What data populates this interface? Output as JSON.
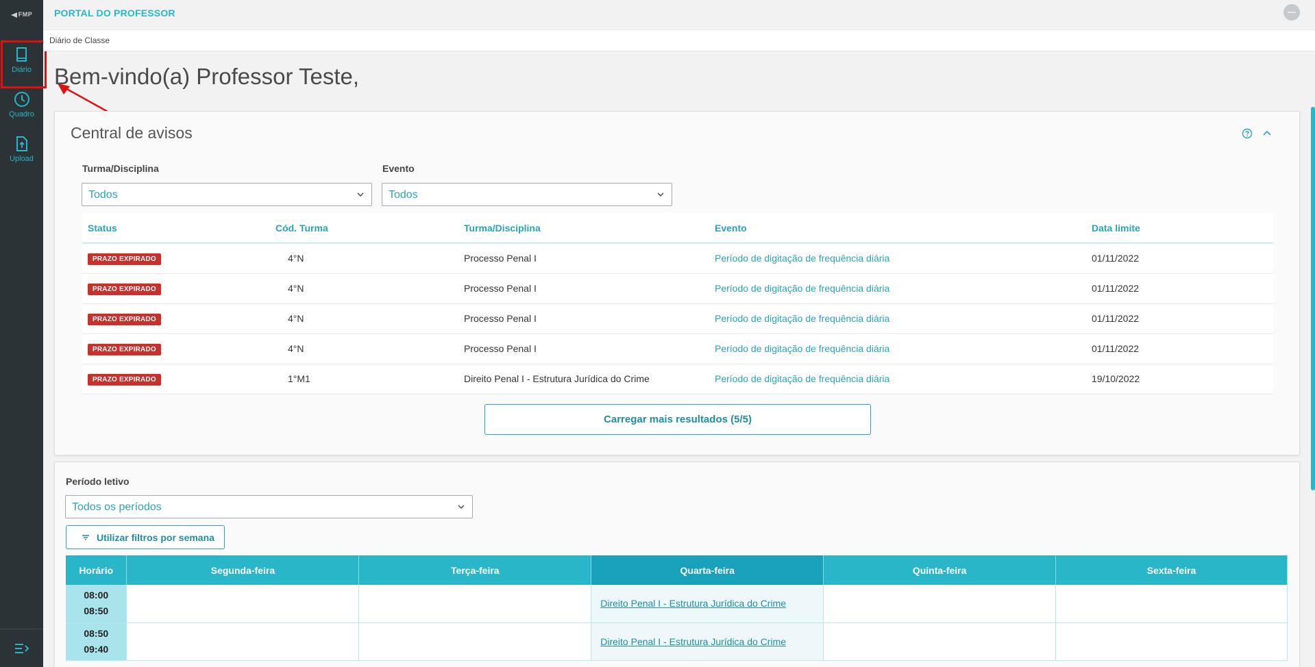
{
  "sidebar": {
    "logo_text": "FMP",
    "items": [
      {
        "label": "Diário",
        "icon": "book-icon"
      },
      {
        "label": "Quadro",
        "icon": "clock-icon"
      },
      {
        "label": "Upload",
        "icon": "upload-file-icon"
      }
    ],
    "collapse_icon": "collapse-menu-icon"
  },
  "header": {
    "app_title": "PORTAL DO PROFESSOR",
    "breadcrumb": "Diário de Classe"
  },
  "welcome": "Bem-vindo(a) Professor Teste,",
  "avisos": {
    "title": "Central de avisos",
    "filters": {
      "turma_label": "Turma/Disciplina",
      "turma_value": "Todos",
      "evento_label": "Evento",
      "evento_value": "Todos"
    },
    "columns": [
      "Status",
      "Cód. Turma",
      "Turma/Disciplina",
      "Evento",
      "Data limite"
    ],
    "rows": [
      {
        "status": "PRAZO EXPIRADO",
        "cod": "4°N",
        "turma": "Processo Penal I",
        "evento": "Período de digitação de frequência diária",
        "data": "01/11/2022"
      },
      {
        "status": "PRAZO EXPIRADO",
        "cod": "4°N",
        "turma": "Processo Penal I",
        "evento": "Período de digitação de frequência diária",
        "data": "01/11/2022"
      },
      {
        "status": "PRAZO EXPIRADO",
        "cod": "4°N",
        "turma": "Processo Penal I",
        "evento": "Período de digitação de frequência diária",
        "data": "01/11/2022"
      },
      {
        "status": "PRAZO EXPIRADO",
        "cod": "4°N",
        "turma": "Processo Penal I",
        "evento": "Período de digitação de frequência diária",
        "data": "01/11/2022"
      },
      {
        "status": "PRAZO EXPIRADO",
        "cod": "1°M1",
        "turma": "Direito Penal I - Estrutura Jurídica do Crime",
        "evento": "Período de digitação de frequência diária",
        "data": "19/10/2022"
      }
    ],
    "load_more": "Carregar mais resultados (5/5)"
  },
  "horario": {
    "periodo_label": "Período letivo",
    "periodo_value": "Todos os períodos",
    "week_filter_button": "Utilizar filtros por semana",
    "columns": [
      "Horário",
      "Segunda-feira",
      "Terça-feira",
      "Quarta-feira",
      "Quinta-feira",
      "Sexta-feira"
    ],
    "rows": [
      {
        "start": "08:00",
        "end": "08:50",
        "quarta": "Direito Penal I - Estrutura Jurídica do Crime"
      },
      {
        "start": "08:50",
        "end": "09:40",
        "quarta": "Direito Penal I - Estrutura Jurídica do Crime"
      }
    ]
  },
  "colors": {
    "accent": "#29b6c8",
    "sidebar_bg": "#2c3336",
    "badge_red": "#c9302c",
    "annotation_red": "#e01010"
  }
}
